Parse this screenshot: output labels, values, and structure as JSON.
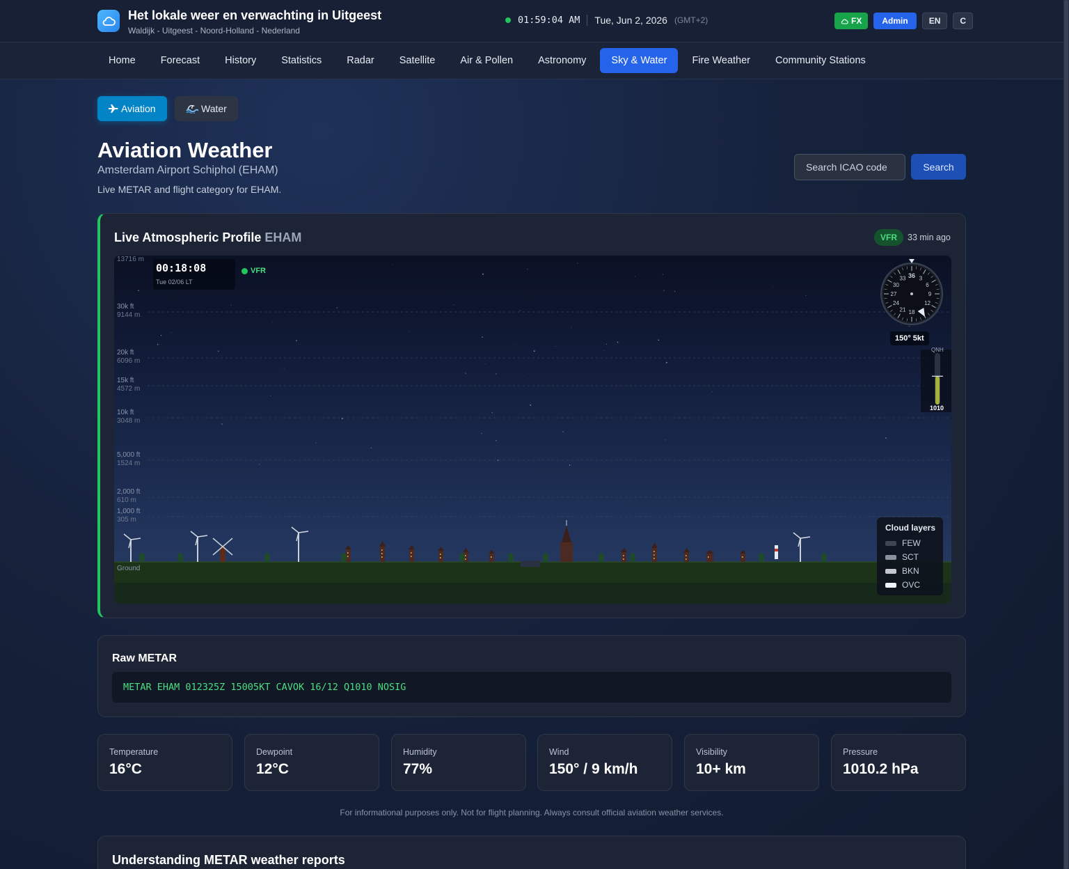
{
  "header": {
    "title": "Het lokale weer en verwachting in Uitgeest",
    "subtitle": "Waldijk - Uitgeest - Noord-Holland - Nederland",
    "time": "01:59:04 AM",
    "date": "Tue, Jun 2, 2026",
    "timezone": "(GMT+2)",
    "fx_label": "FX",
    "admin_label": "Admin",
    "lang_label": "EN",
    "unit_label": "C",
    "status_color": "#22c55e"
  },
  "nav": {
    "items": [
      "Home",
      "Forecast",
      "History",
      "Statistics",
      "Radar",
      "Satellite",
      "Air & Pollen",
      "Astronomy",
      "Sky & Water",
      "Fire Weather",
      "Community Stations"
    ],
    "active": "Sky & Water"
  },
  "subtabs": {
    "aviation": "Aviation",
    "water": "Water"
  },
  "page": {
    "title": "Aviation Weather",
    "airport": "Amsterdam Airport Schiphol (EHAM)",
    "description": "Live METAR and flight category for EHAM."
  },
  "search": {
    "placeholder": "Search ICAO code",
    "button": "Search"
  },
  "profile": {
    "title": "Live Atmospheric Profile",
    "icao": "EHAM",
    "category": "VFR",
    "age": "33 min ago",
    "altitudes": [
      {
        "ft": "",
        "m": "13716 m"
      },
      {
        "ft": "30k ft",
        "m": "9144 m"
      },
      {
        "ft": "20k ft",
        "m": "6096 m"
      },
      {
        "ft": "15k ft",
        "m": "4572 m"
      },
      {
        "ft": "10k ft",
        "m": "3048 m"
      },
      {
        "ft": "5,000 ft",
        "m": "1524 m"
      },
      {
        "ft": "2,000 ft",
        "m": "610 m"
      },
      {
        "ft": "1,000 ft",
        "m": "305 m"
      }
    ],
    "ground_label": "Ground",
    "scene_time": "00:18:08",
    "scene_date": "Tue 02/06   LT",
    "scene_category": "VFR",
    "compass_labels": [
      "36",
      "3",
      "6",
      "9",
      "12",
      "18",
      "21",
      "24",
      "27",
      "30",
      "33"
    ],
    "wind_direction_deg": 150,
    "wind_readout": "150°  5kt",
    "qnh_label": "QNH",
    "qnh_value": "1010",
    "qnh_level": 0.55,
    "legend": {
      "title": "Cloud layers",
      "items": [
        {
          "label": "FEW",
          "color": "#3f4656"
        },
        {
          "label": "SCT",
          "color": "#8a919e"
        },
        {
          "label": "BKN",
          "color": "#c4c9d1"
        },
        {
          "label": "OVC",
          "color": "#f1f3f6"
        }
      ]
    }
  },
  "metar": {
    "title": "Raw METAR",
    "code": "METAR EHAM 012325Z 15005KT CAVOK 16/12 Q1010 NOSIG"
  },
  "stats": [
    {
      "label": "Temperature",
      "value": "16°C"
    },
    {
      "label": "Dewpoint",
      "value": "12°C"
    },
    {
      "label": "Humidity",
      "value": "77%"
    },
    {
      "label": "Wind",
      "value": "150° / 9 km/h"
    },
    {
      "label": "Visibility",
      "value": "10+ km"
    },
    {
      "label": "Pressure",
      "value": "1010.2 hPa"
    }
  ],
  "disclaimer": "For informational purposes only. Not for flight planning. Always consult official aviation weather services.",
  "understanding": {
    "title": "Understanding METAR weather reports"
  }
}
